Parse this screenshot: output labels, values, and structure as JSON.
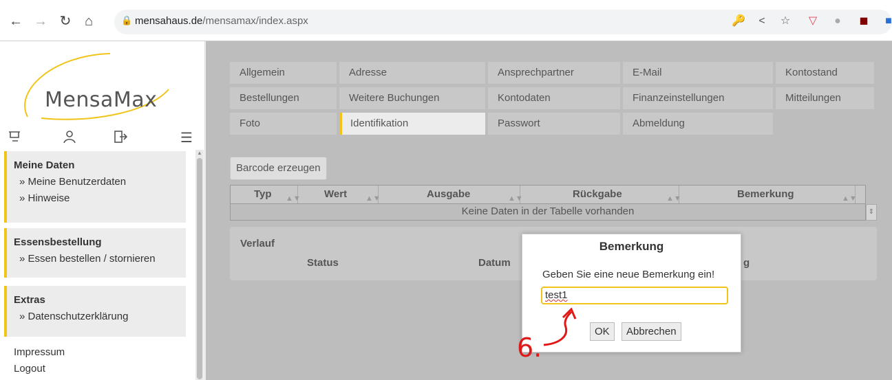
{
  "browser": {
    "url_domain": "mensahaus.de",
    "url_path": "/mensamax/index.aspx"
  },
  "sidebar": {
    "logo_text": "MensaMax",
    "icons": [
      "cart-icon",
      "user-icon",
      "logout-icon",
      "menu-icon"
    ],
    "sections": [
      {
        "title": "Meine Daten",
        "items": [
          "» Meine Benutzerdaten",
          "» Hinweise"
        ]
      },
      {
        "title": "Essensbestellung",
        "items": [
          "» Essen bestellen / stornieren"
        ]
      },
      {
        "title": "Extras",
        "items": [
          "» Datenschutzerklärung"
        ]
      }
    ],
    "links": [
      "Impressum",
      "Logout"
    ]
  },
  "tabs": {
    "row1": [
      "Allgemein",
      "Adresse",
      "Ansprechpartner",
      "E-Mail",
      "Kontostand"
    ],
    "row2": [
      "Bestellungen",
      "Weitere Buchungen",
      "Kontodaten",
      "Finanzeinstellungen",
      "Mitteilungen"
    ],
    "row3": [
      "Foto",
      "Identifikation",
      "Passwort",
      "Abmeldung"
    ],
    "active": "Identifikation"
  },
  "main": {
    "barcode_button": "Barcode erzeugen",
    "table": {
      "columns": [
        "Typ",
        "Wert",
        "Ausgabe",
        "Rückgabe",
        "Bemerkung"
      ],
      "empty_text": "Keine Daten in der Tabelle vorhanden"
    },
    "verlauf": {
      "title": "Verlauf",
      "columns": [
        "Status",
        "Datum",
        "g"
      ]
    }
  },
  "dialog": {
    "title": "Bemerkung",
    "message": "Geben Sie eine neue Bemerkung ein!",
    "input_value": "test1",
    "ok_label": "OK",
    "cancel_label": "Abbrechen"
  },
  "annotation": {
    "label": "6.",
    "color": "#e01818"
  },
  "colors": {
    "accent": "#f0c419",
    "overlay": "#bdbdbd"
  }
}
